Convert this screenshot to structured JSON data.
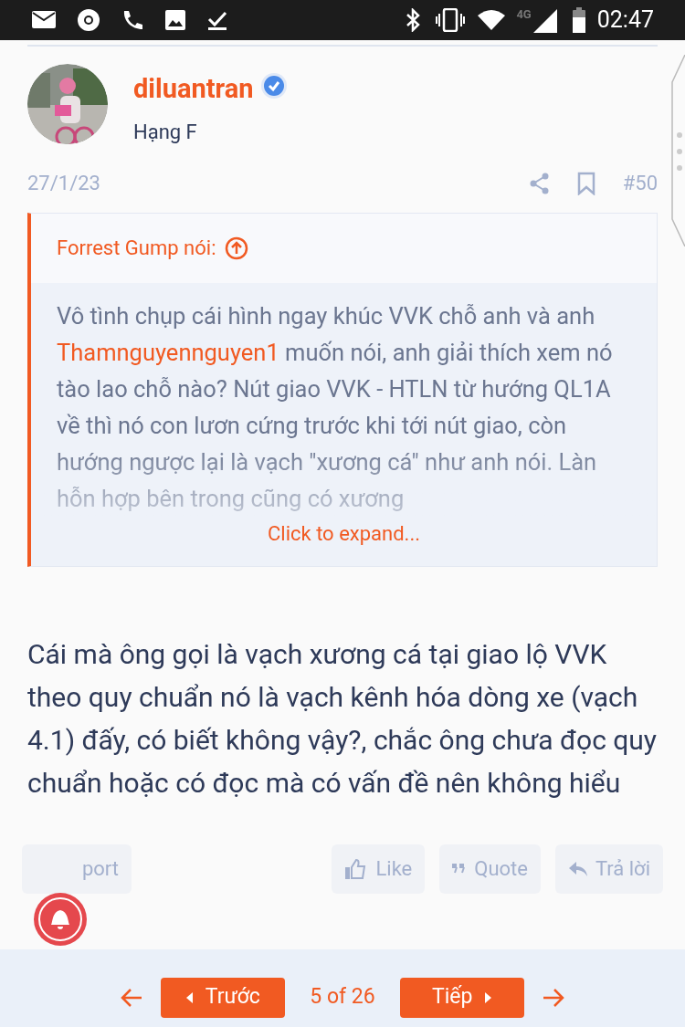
{
  "status_bar": {
    "network": "4G",
    "time": "02:47"
  },
  "post": {
    "author": "diluantran",
    "verified": true,
    "rank": "Hạng F",
    "date": "27/1/23",
    "number": "#50",
    "quote": {
      "header": "Forrest Gump nói:",
      "parts": [
        {
          "kind": "text",
          "text": "Vô tình chụp cái hình ngay khúc VVK chỗ anh và anh "
        },
        {
          "kind": "mention",
          "text": "Thamnguyennguyen1"
        },
        {
          "kind": "text",
          "text": " muốn nói, anh giải thích xem nó tào lao chỗ nào? Nút giao VVK - HTLN từ hướng QL1A về thì nó con lươn cứng trước khi tới nút giao, còn hướng ngược lại là vạch \"xương cá\" như anh nói. Làn hỗn hợp bên trong cũng có xương"
        }
      ],
      "expand": "Click to expand..."
    },
    "body": "Cái mà ông gọi là vạch xương cá tại giao lộ VVK theo quy chuẩn nó là vạch kênh hóa dòng xe (vạch 4.1) đấy, có biết không vậy?, chắc ông chưa đọc quy chuẩn hoặc có đọc mà có vấn đề nên không hiểu",
    "actions": [
      {
        "kind": "report",
        "label": "port"
      },
      {
        "kind": "like",
        "label": "Like"
      },
      {
        "kind": "quote",
        "label": "Quote"
      },
      {
        "kind": "reply",
        "label": "Trả lời"
      }
    ]
  },
  "pagination": {
    "prev": "Trước",
    "page": "5 of 26",
    "next": "Tiếp"
  }
}
